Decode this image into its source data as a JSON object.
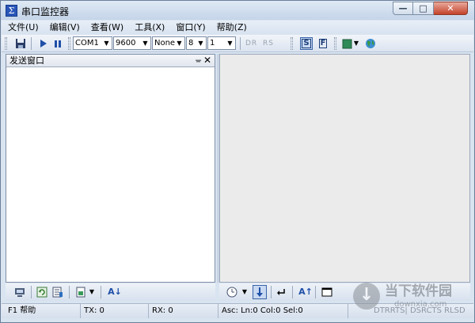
{
  "window": {
    "title": "串口监控器",
    "app_icon_glyph": "Σ",
    "buttons": {
      "minimize": "—",
      "maximize": "□",
      "close": "✕"
    }
  },
  "menu": [
    {
      "label": "文件(U)"
    },
    {
      "label": "编辑(V)"
    },
    {
      "label": "查看(W)"
    },
    {
      "label": "工具(X)"
    },
    {
      "label": "窗口(Y)"
    },
    {
      "label": "帮助(Z)"
    }
  ],
  "toolbar": {
    "port": "COM1",
    "baud": "9600",
    "parity": "None",
    "databits": "8",
    "stopbits": "1",
    "dr_label": "DR",
    "rs_label": "RS",
    "s_button": "S",
    "f_button": "F",
    "colors": {
      "record": "#2e8a57",
      "play": "#1f4fa8",
      "globe": "#3b9a3b"
    }
  },
  "send_panel": {
    "title": "发送窗口",
    "pin_glyph": "ᚚ",
    "close_glyph": "✕"
  },
  "bottom_left_tools": {
    "font_label": "A↓"
  },
  "bottom_right_tools": {
    "font_label": "A↑"
  },
  "status": {
    "help": "F1 帮助",
    "tx": "TX: 0",
    "rx": "RX: 0",
    "position": "Asc: Ln:0  Col:0  Sel:0",
    "signals": "DTRRTS| DSRCTS RLSD"
  },
  "watermark": {
    "cn": "当下软件园",
    "en": "downxia.com"
  }
}
